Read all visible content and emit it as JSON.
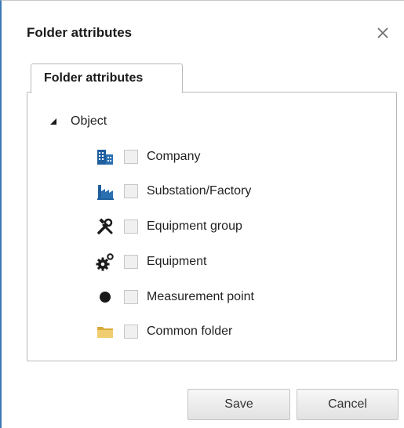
{
  "dialog": {
    "title": "Folder attributes",
    "close_icon": "close-icon"
  },
  "tabs": [
    {
      "label": "Folder attributes",
      "selected": true
    }
  ],
  "tree": {
    "root": {
      "label": "Object",
      "expanded": true,
      "icon": "collapse-triangle-icon"
    },
    "items": [
      {
        "label": "Company",
        "icon": "company-buildings-icon",
        "checked": false
      },
      {
        "label": "Substation/Factory",
        "icon": "factory-icon",
        "checked": false
      },
      {
        "label": "Equipment group",
        "icon": "tools-icon",
        "checked": false
      },
      {
        "label": "Equipment",
        "icon": "gears-icon",
        "checked": false
      },
      {
        "label": "Measurement point",
        "icon": "dot-icon",
        "checked": false
      },
      {
        "label": "Common folder",
        "icon": "folder-icon",
        "checked": false
      }
    ]
  },
  "footer": {
    "save_label": "Save",
    "cancel_label": "Cancel"
  },
  "colors": {
    "window_border": "#3d78b6",
    "icon_blue": "#1f5f9e",
    "folder_yellow": "#e9c46a"
  }
}
